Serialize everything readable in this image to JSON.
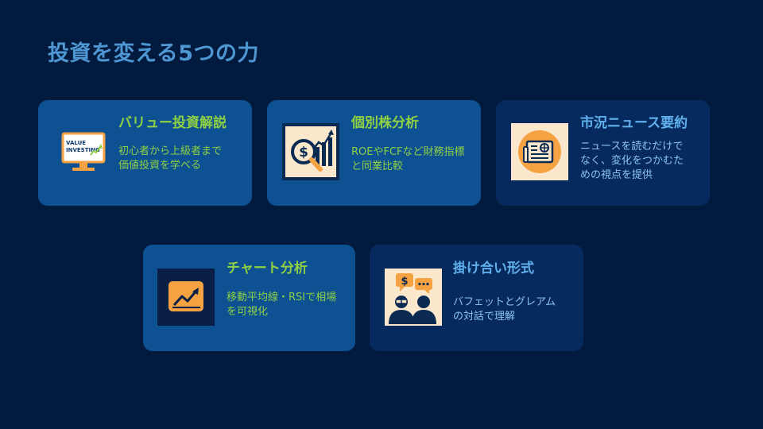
{
  "slide": {
    "title": "投資を変える5つの力"
  },
  "cards": [
    {
      "title": "バリュー投資解説",
      "description": "初心者から上級者まで\n価値投資を学べる",
      "icon": "value-investing-monitor-icon",
      "icon_text_line1": "VALUE",
      "icon_text_line2": "INVESTING"
    },
    {
      "title": "個別株分析",
      "description": "ROEやFCFなど財務指標\nと同業比較",
      "icon": "dollar-magnifier-chart-icon"
    },
    {
      "title": "市況ニュース要約",
      "description": "ニュースを読むだけで\nなく、変化をつかむた\nめの視点を提供",
      "icon": "newspaper-icon"
    },
    {
      "title": "チャート分析",
      "description": "移動平均線・RSIで相場\nを可視化",
      "icon": "trend-chart-icon"
    },
    {
      "title": "掛け合い形式",
      "description": "バフェットとグレアム\nの対話で理解",
      "icon": "conversation-people-icon",
      "icon_symbol": "$"
    }
  ],
  "colors": {
    "background": "#021a3d",
    "card_light": "#0d5193",
    "card_dark": "#062a5e",
    "title_blue": "#4f97d3",
    "accent_green": "#8fcf44",
    "accent_blue": "#5fb0ec",
    "icon_orange": "#f5a242"
  }
}
